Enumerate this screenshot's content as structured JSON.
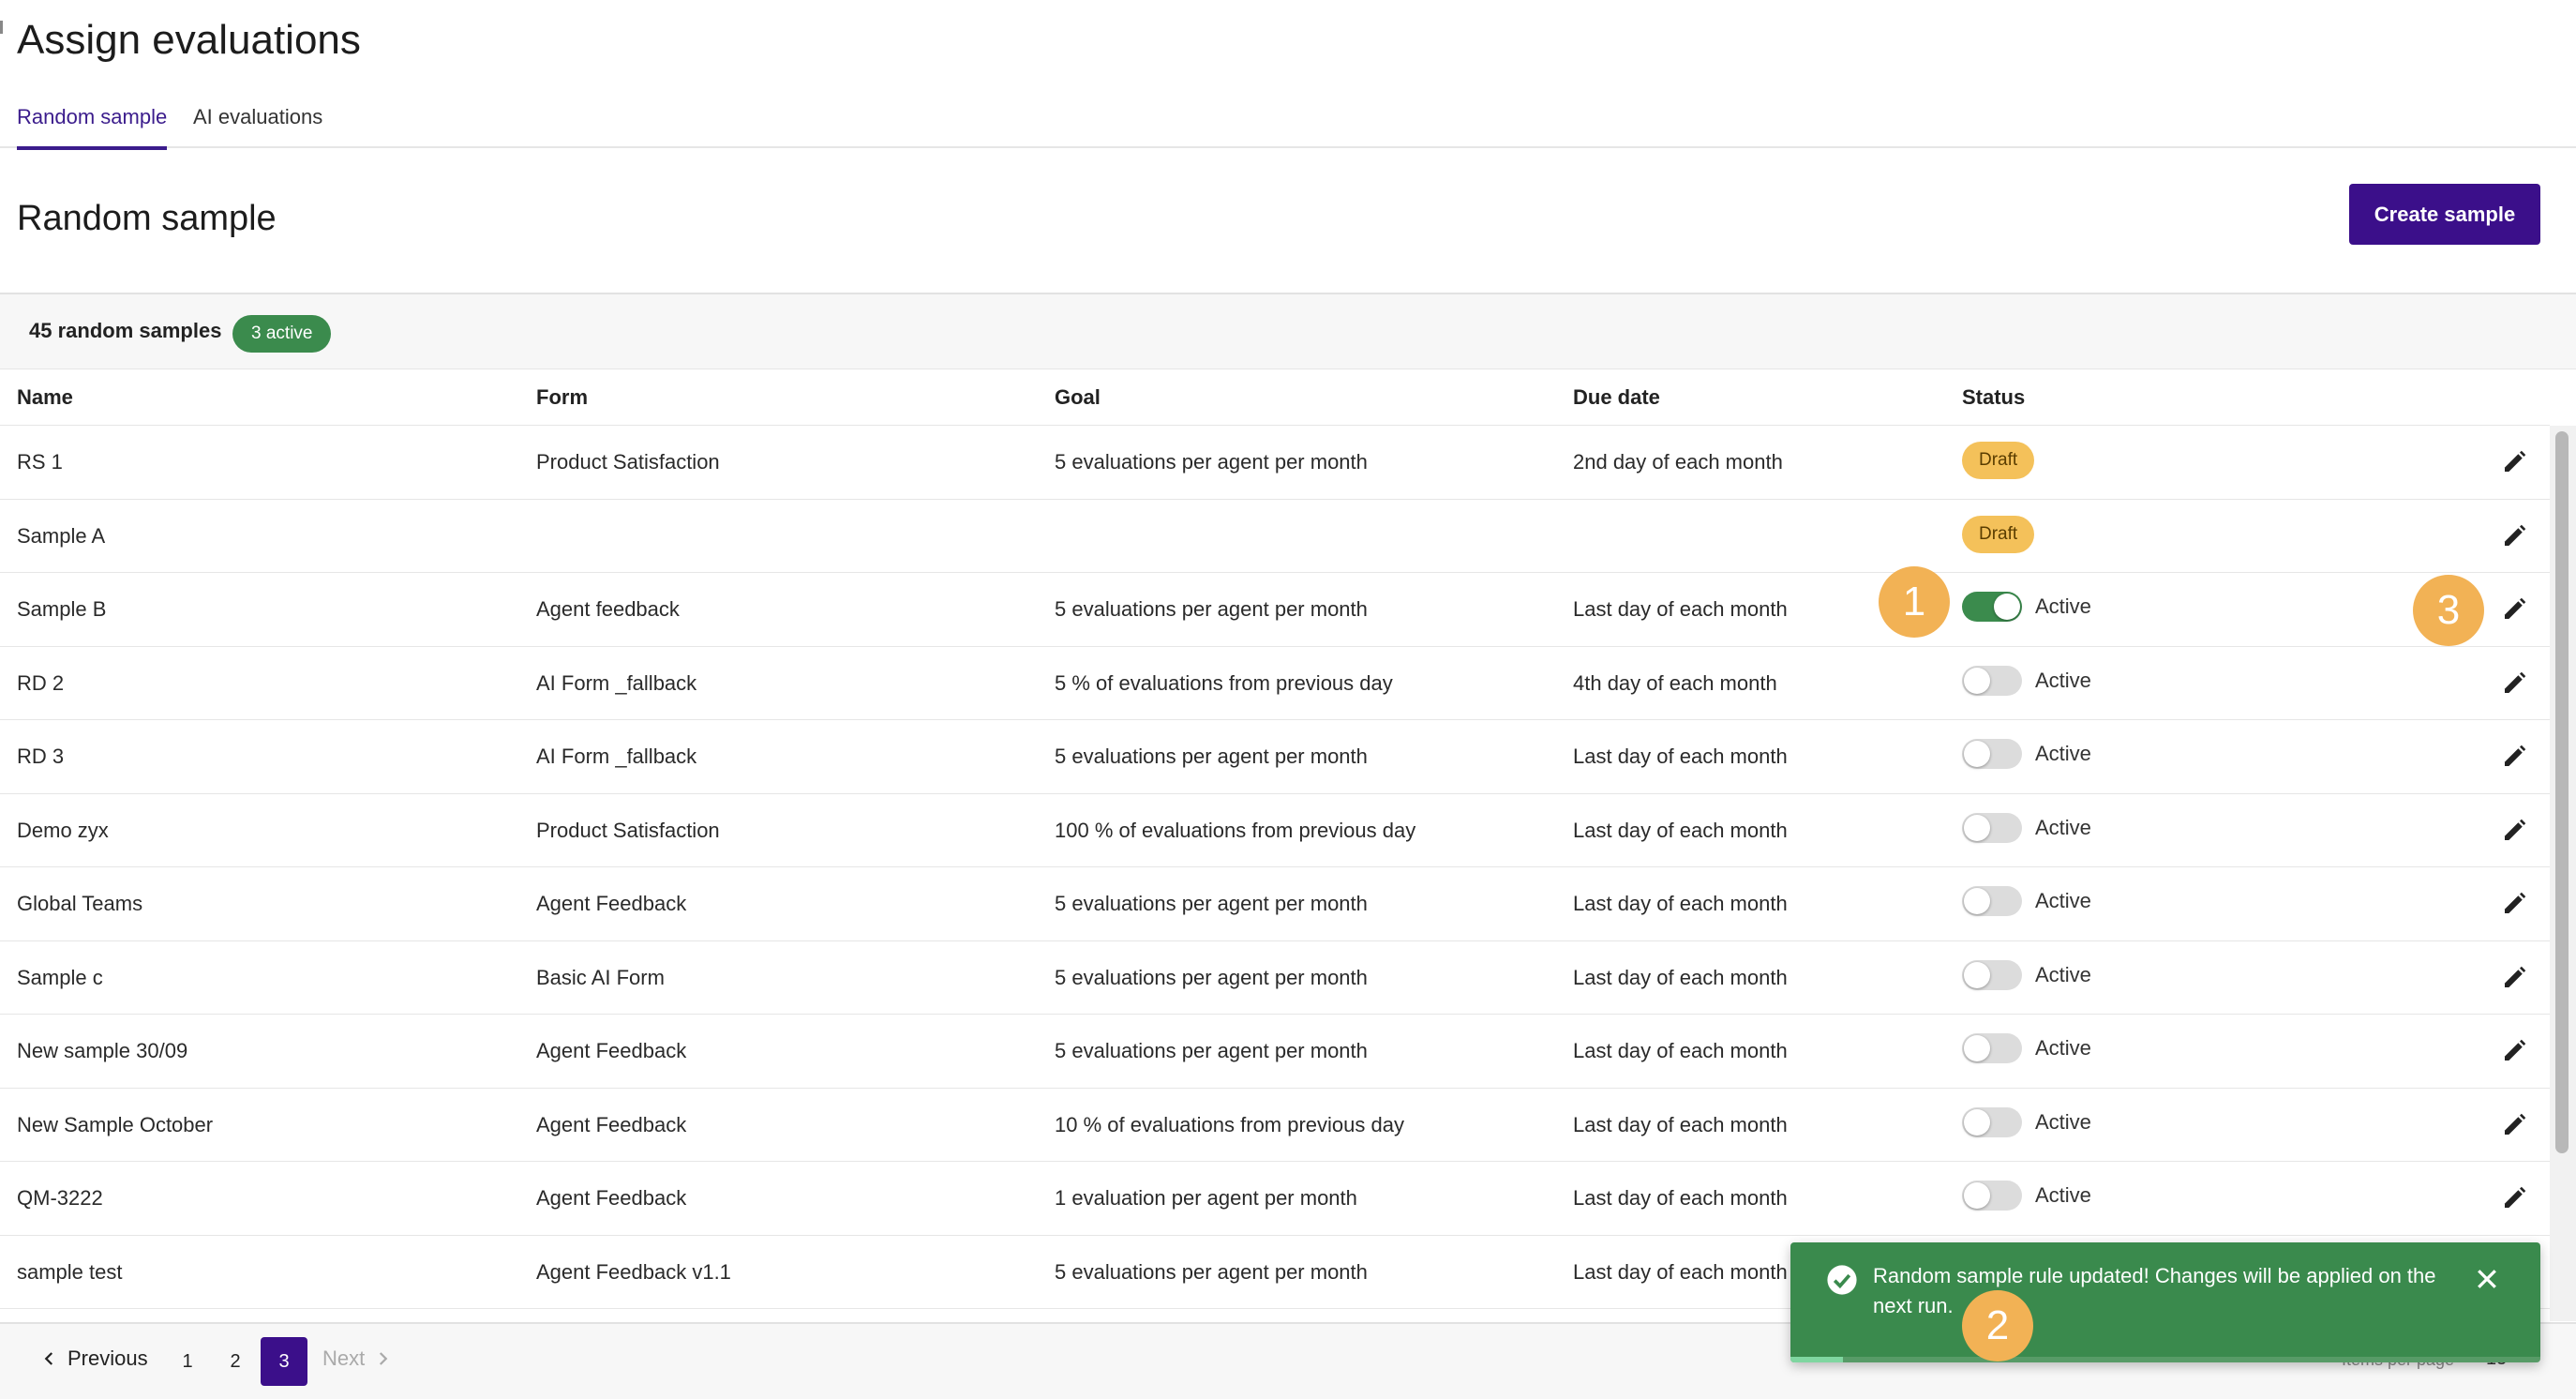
{
  "page": {
    "title": "Assign evaluations"
  },
  "tabs": [
    {
      "label": "Random sample",
      "active": true
    },
    {
      "label": "AI evaluations",
      "active": false
    }
  ],
  "section": {
    "title": "Random sample",
    "create_button": "Create sample"
  },
  "summary": {
    "count_label": "45 random samples",
    "active_badge": "3 active"
  },
  "table": {
    "headers": {
      "name": "Name",
      "form": "Form",
      "goal": "Goal",
      "due": "Due date",
      "status": "Status"
    },
    "rows": [
      {
        "name": "RS 1",
        "form": "Product Satisfaction",
        "goal": "5 evaluations per agent per month",
        "due": "2nd day of each month",
        "status": "Draft"
      },
      {
        "name": "Sample A",
        "form": "",
        "goal": "",
        "due": "",
        "status": "Draft"
      },
      {
        "name": "Sample B",
        "form": "Agent feedback",
        "goal": "5 evaluations per agent per month",
        "due": "Last day of each month",
        "status": "Active"
      },
      {
        "name": "RD 2",
        "form": "AI Form _fallback",
        "goal": "5 % of evaluations from previous day",
        "due": "4th day of each month",
        "status": "Active"
      },
      {
        "name": "RD 3",
        "form": "AI Form _fallback",
        "goal": "5 evaluations per agent per month",
        "due": "Last day of each month",
        "status": "Active"
      },
      {
        "name": "Demo zyx",
        "form": "Product Satisfaction",
        "goal": "100 % of evaluations from previous day",
        "due": "Last day of each month",
        "status": "Active"
      },
      {
        "name": "Global Teams",
        "form": "Agent Feedback",
        "goal": "5 evaluations per agent per month",
        "due": "Last day of each month",
        "status": "Active"
      },
      {
        "name": "Sample c",
        "form": "Basic AI Form",
        "goal": "5 evaluations per agent per month",
        "due": "Last day of each month",
        "status": "Active"
      },
      {
        "name": "New sample 30/09",
        "form": "Agent Feedback",
        "goal": "5 evaluations per agent per month",
        "due": "Last day of each month",
        "status": "Active"
      },
      {
        "name": "New Sample October",
        "form": "Agent Feedback",
        "goal": "10 % of evaluations from previous day",
        "due": "Last day of each month",
        "status": "Active"
      },
      {
        "name": "QM-3222",
        "form": "Agent Feedback",
        "goal": "1 evaluation per agent per month",
        "due": "Last day of each month",
        "status": "Active"
      },
      {
        "name": "sample test",
        "form": "Agent Feedback v1.1",
        "goal": "5 evaluations per agent per month",
        "due": "Last day of each month",
        "status": ""
      }
    ]
  },
  "toggles": [
    null,
    null,
    true,
    false,
    false,
    false,
    false,
    false,
    false,
    false,
    false,
    null
  ],
  "pagination": {
    "previous": "Previous",
    "next": "Next",
    "pages": [
      "1",
      "2",
      "3"
    ],
    "current": "3",
    "items_per_page_label": "Items per page",
    "items_per_page_value": "15"
  },
  "toast": {
    "message": "Random sample rule updated! Changes will be applied on the next run.",
    "progress": 0.07
  },
  "callouts": [
    "1",
    "2",
    "3"
  ],
  "colors": {
    "accent": "#3b0f8a",
    "success": "#3a8a4d",
    "draft": "#f4c15a",
    "callout": "#f2b255"
  },
  "icons": {
    "edit": "pencil-icon",
    "toast": "check-circle-icon",
    "close": "close-icon",
    "prev": "chevron-left-icon",
    "next": "chevron-right-icon"
  }
}
